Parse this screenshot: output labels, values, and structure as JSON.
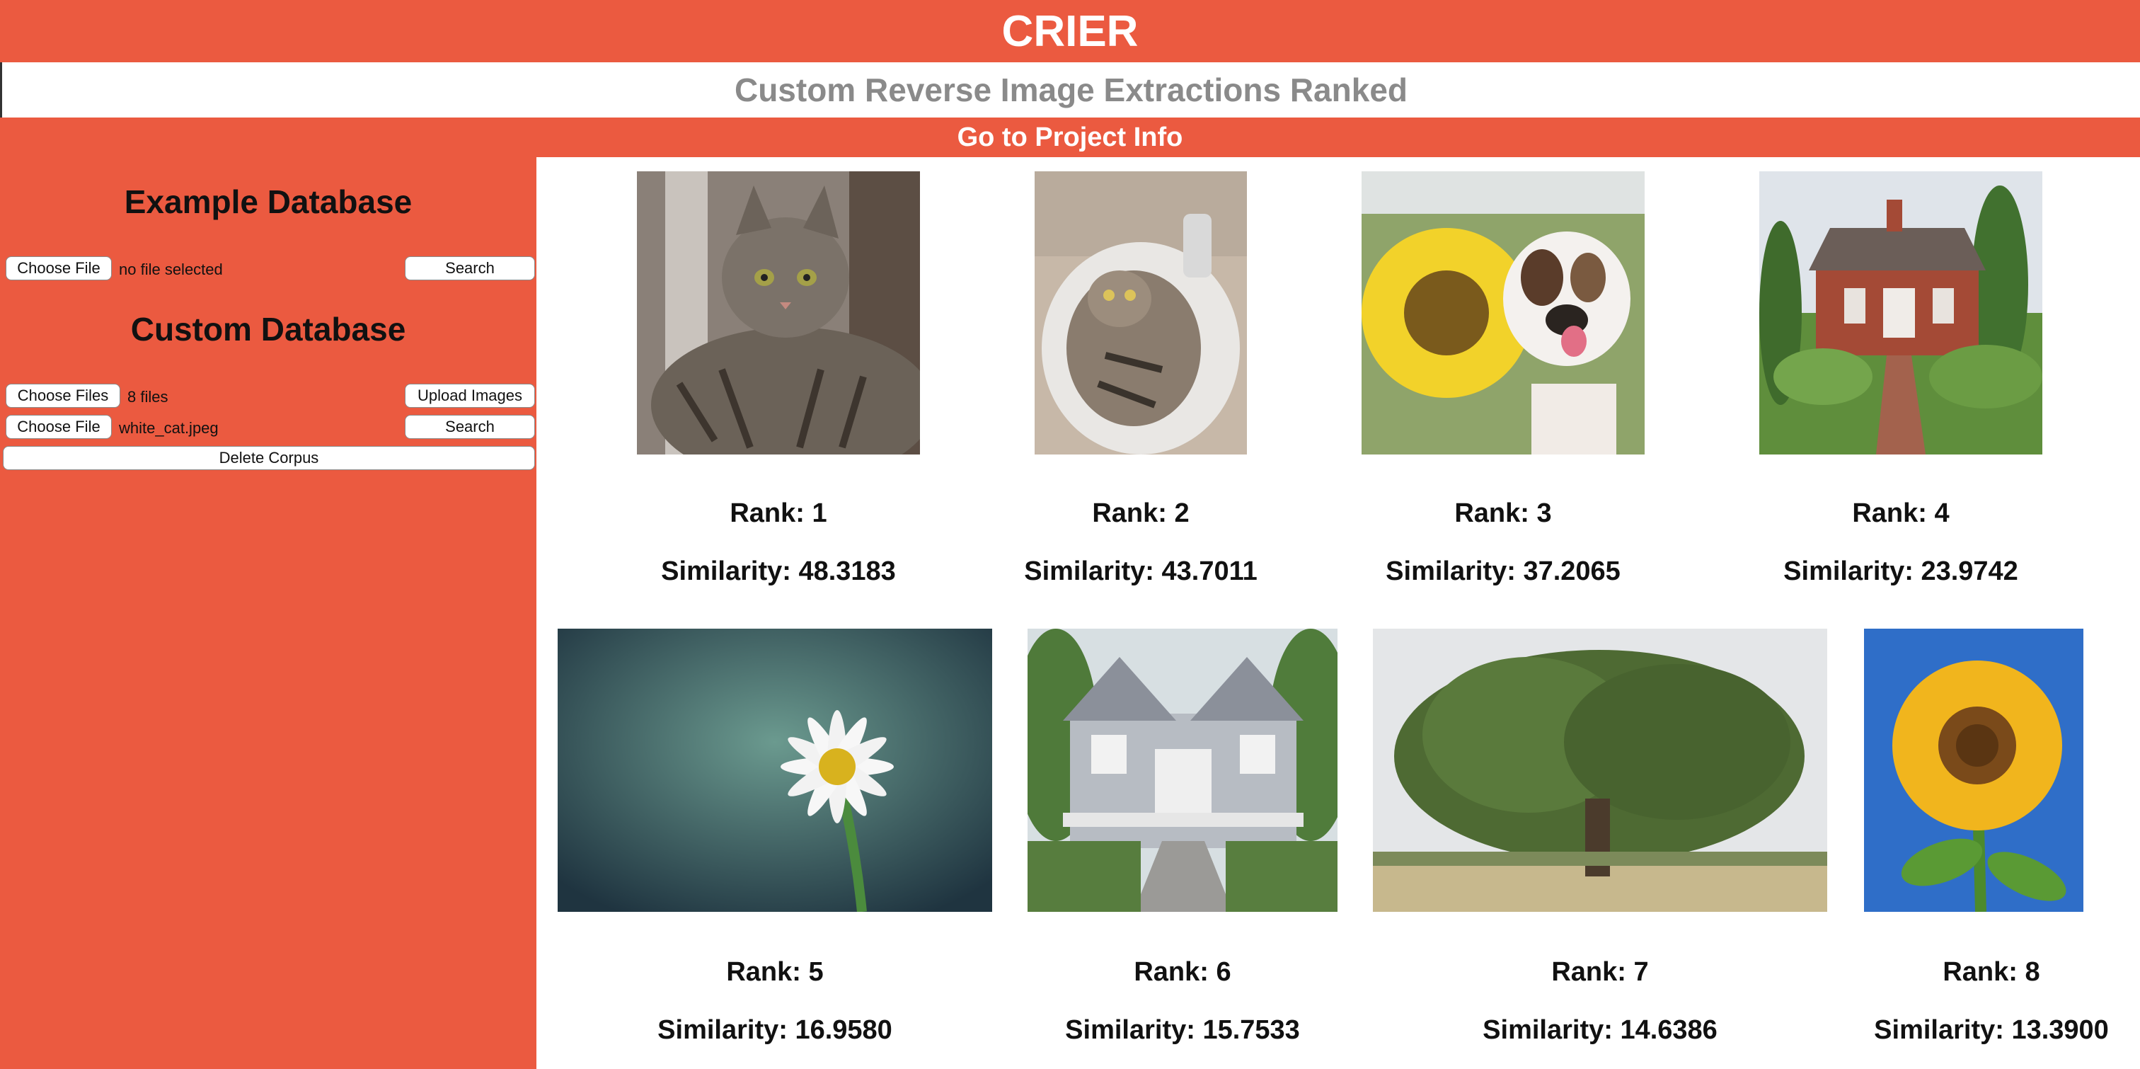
{
  "app": {
    "title": "CRIER",
    "subtitle": "Custom Reverse Image Extractions Ranked",
    "project_link": "Go to Project Info"
  },
  "sidebar": {
    "example": {
      "heading": "Example Database",
      "choose_label": "Choose File",
      "file_status": "no file selected",
      "search_label": "Search"
    },
    "custom": {
      "heading": "Custom Database",
      "choose_files_label": "Choose Files",
      "files_status": "8 files",
      "upload_label": "Upload Images",
      "choose_query_label": "Choose File",
      "query_file": "white_cat.jpeg",
      "search_label": "Search",
      "delete_label": "Delete Corpus"
    }
  },
  "results": [
    {
      "rank": "Rank: 1",
      "similarity": "Similarity: 48.3183",
      "image": "tabby-cat-photo"
    },
    {
      "rank": "Rank: 2",
      "similarity": "Similarity: 43.7011",
      "image": "cat-in-sink-photo"
    },
    {
      "rank": "Rank: 3",
      "similarity": "Similarity: 37.2065",
      "image": "sunflower-puppy-photo"
    },
    {
      "rank": "Rank: 4",
      "similarity": "Similarity: 23.9742",
      "image": "brick-cottage-photo"
    },
    {
      "rank": "Rank: 5",
      "similarity": "Similarity: 16.9580",
      "image": "daisy-photo"
    },
    {
      "rank": "Rank: 6",
      "similarity": "Similarity: 15.7533",
      "image": "white-house-photo"
    },
    {
      "rank": "Rank: 7",
      "similarity": "Similarity: 14.6386",
      "image": "oak-tree-photo"
    },
    {
      "rank": "Rank: 8",
      "similarity": "Similarity: 13.3900",
      "image": "sunflower-sky-photo"
    }
  ],
  "colors": {
    "accent": "#eb5a40",
    "subtitle_text": "#8a8a8a"
  }
}
